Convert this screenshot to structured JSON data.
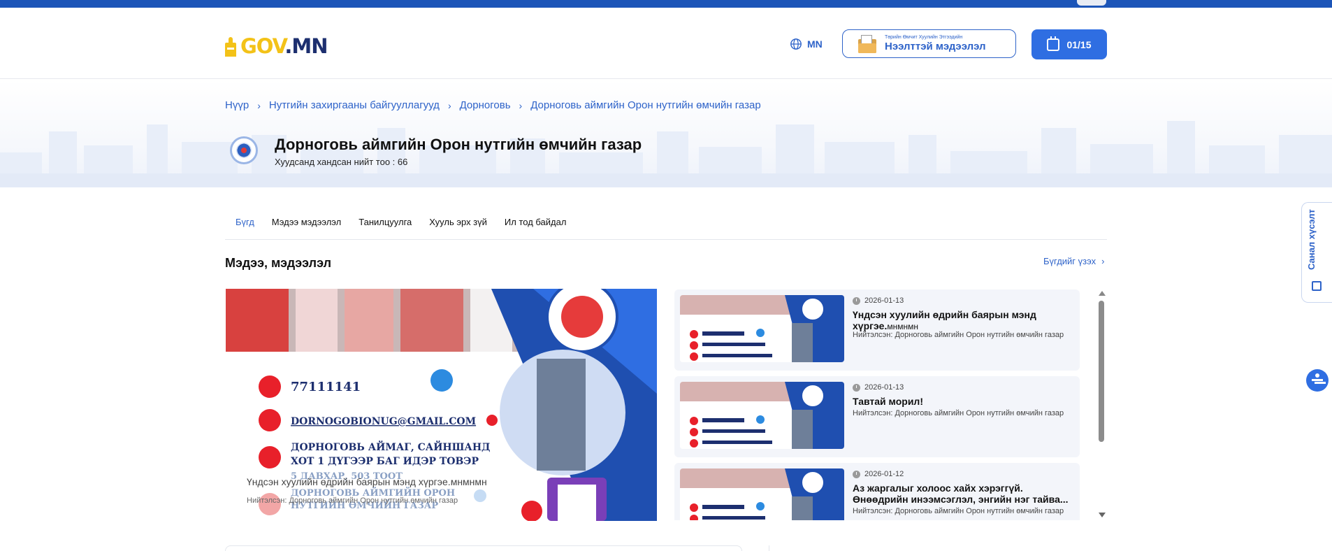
{
  "header": {
    "logo": {
      "part1": "GOV",
      "part2": ".MN"
    },
    "language": "MN",
    "info_box": {
      "small_text": "Төрийн Өмчит Хуулийн Этгээдийн",
      "title": "Нээлттэй мэдээлэл"
    },
    "date_badge": "01/15"
  },
  "breadcrumb": [
    "Нүүр",
    "Нутгийн захиргааны байгууллагууд",
    "Дорноговь",
    "Дорноговь аймгийн Орон нутгийн өмчийн газар"
  ],
  "organization": {
    "title": "Дорноговь аймгийн Орон нутгийн өмчийн газар",
    "visit_count": "Хуудсанд хандсан нийт тоо : 66"
  },
  "tabs": [
    "Бүгд",
    "Мэдээ мэдээлэл",
    "Танилцуулга",
    "Хууль эрх зүй",
    "Ил тод байдал"
  ],
  "section": {
    "title": "Мэдээ, мэдээлэл",
    "see_all": "Бүгдийг үзэх"
  },
  "poster": {
    "phone": "77111141",
    "email": "DORNOGOBIONUG@GMAIL.COM",
    "address_line1": "ДОРНОГОВЬ АЙМАГ, САЙНШАНД",
    "address_line2": "ХОТ 1 ДҮГЭЭР БАГ ИДЭР ТОВЭР",
    "address_line3": "5 ДАВХАР, 503 ТООТ",
    "org_line1": "ДОРНОГОВЬ АЙМГИЙН ОРОН",
    "org_line2": "НУТГИЙН ӨМЧИЙН ГАЗАР"
  },
  "featured": {
    "caption": "Үндсэн хуулийн өдрийн баярын мэнд хүргэе.мнмнмн",
    "publisher": "Нийтэлсэн: Дорноговь аймгийн Орон нутгийн өмчийн газар"
  },
  "news": [
    {
      "date": "2026-01-13",
      "title": "Үндсэн хуулийн өдрийн баярын мэнд хүргэе.",
      "title_suffix": "мнмнмн",
      "publisher": "Нийтэлсэн: Дорноговь аймгийн Орон нутгийн өмчийн газар"
    },
    {
      "date": "2026-01-13",
      "title": "Тавтай морил!",
      "title_suffix": "",
      "publisher": "Нийтэлсэн: Дорноговь аймгийн Орон нутгийн өмчийн газар"
    },
    {
      "date": "2026-01-12",
      "title": "Аз жаргалыг холоос хайх хэрэггүй. Өнөөдрийн инээмсэглэл, энгийн нэг тайва...",
      "title_suffix": "",
      "publisher": "Нийтэлсэн: Дорноговь аймгийн Орон нутгийн өмчийн газар"
    }
  ],
  "feedback_tab": "Санал хүсэлт",
  "colors": {
    "primary": "#2e63c9",
    "topbar": "#1c55b8",
    "logo_yellow": "#f3c218",
    "logo_navy": "#1d2f6f"
  },
  "icons": [
    "globe-icon",
    "folder-icon",
    "calendar-icon",
    "chevron-right-icon",
    "clock-icon",
    "accessibility-icon",
    "edit-icon"
  ]
}
